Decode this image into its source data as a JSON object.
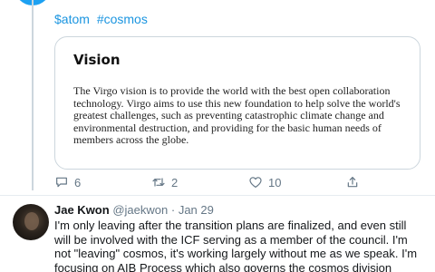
{
  "tweet": {
    "hashtags": [
      "$atom",
      "#cosmos"
    ],
    "card": {
      "title": "Vision",
      "body": "The Virgo vision is to provide the world with the best open collaboration technology. Virgo aims to use this new foundation to help solve the world's greatest challenges, such as preventing catastrophic climate change and environmental destruction, and providing for the basic human needs of members across the globe."
    },
    "actions": {
      "reply_count": "6",
      "retweet_count": "2",
      "like_count": "10"
    }
  },
  "reply": {
    "name": "Jae Kwon",
    "handle": "@jaekwon",
    "separator": "·",
    "date": "Jan 29",
    "text": "I'm only leaving after the transition plans are finalized, and even still will be involved with the ICF serving as a member of the council.  I'm not \"leaving\" cosmos, it's working largely without me as we speak.  I'm focusing on AIB Process which also governs the cosmos division"
  },
  "colors": {
    "link": "#1b95e0",
    "muted": "#657786",
    "border": "#ccd6dd"
  }
}
